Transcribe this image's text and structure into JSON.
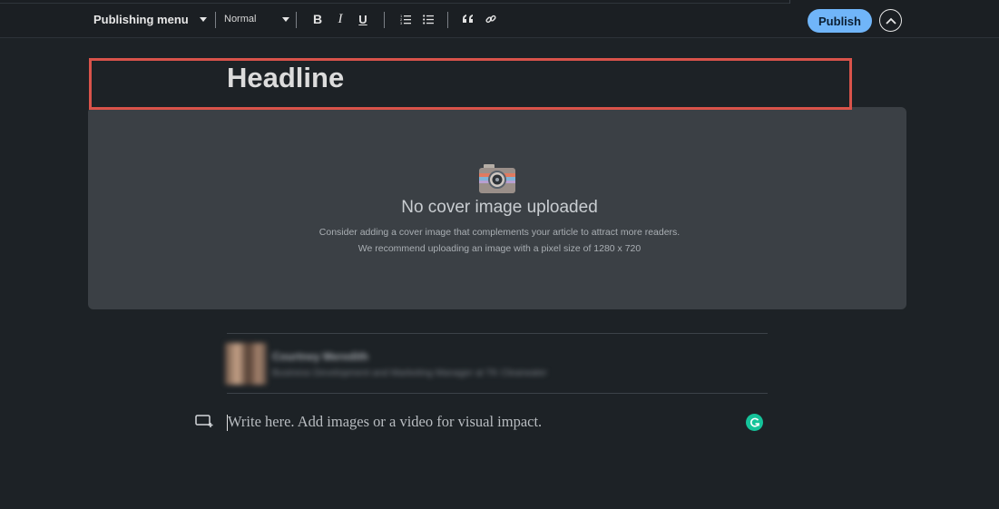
{
  "toolbar": {
    "publishing_menu_label": "Publishing menu",
    "text_style_value": "Normal",
    "bold_label": "B",
    "italic_label": "I",
    "underline_label": "U",
    "publish_label": "Publish",
    "icons": [
      "chevron-down-icon",
      "bold-icon",
      "italic-icon",
      "underline-icon",
      "numbered-list-icon",
      "bulleted-list-icon",
      "quote-icon",
      "link-icon",
      "collapse-up-icon"
    ]
  },
  "editor": {
    "headline_placeholder": "Headline",
    "cover": {
      "title": "No cover image uploaded",
      "line1": "Consider adding a cover image that complements your article to attract more readers.",
      "line2": "We recommend uploading an image with a pixel size of 1280 x 720",
      "icon": "camera-icon"
    },
    "author": {
      "name": "Courtney Meredith",
      "role": "Business Development and Marketing Manager at TK Clearwater"
    },
    "body_placeholder": "Write here. Add images or a video for visual impact.",
    "media_icon": "add-media-icon",
    "grammarly_icon": "grammarly-icon"
  },
  "colors": {
    "background": "#1d2226",
    "toolbar": "#1b1f23",
    "publish_button": "#70b5f9",
    "cover_panel": "#3b4045",
    "headline_highlight": "#d9534a",
    "grammarly": "#15c39a"
  }
}
